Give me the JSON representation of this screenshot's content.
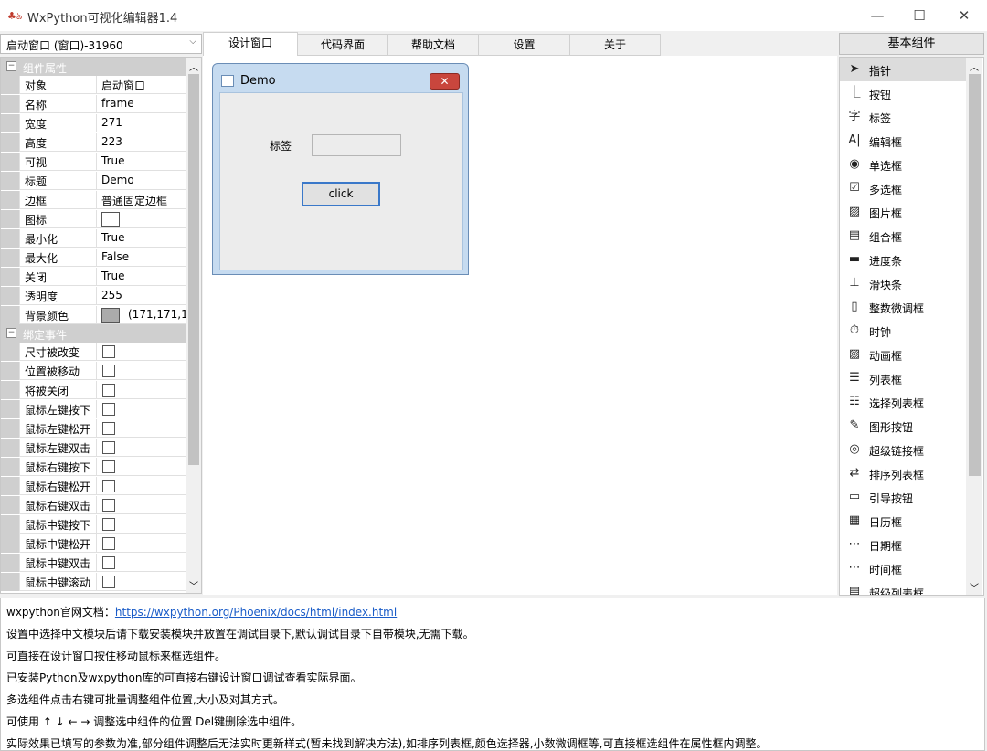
{
  "window": {
    "title": "WxPython可视化编辑器1.4",
    "minimize": "—",
    "maximize": "☐",
    "close": "✕"
  },
  "left": {
    "combo_value": "启动窗口 (窗口)-31960",
    "category1": "组件属性",
    "properties": [
      {
        "key": "对象",
        "value": "启动窗口"
      },
      {
        "key": "名称",
        "value": "frame"
      },
      {
        "key": "宽度",
        "value": "271"
      },
      {
        "key": "高度",
        "value": "223"
      },
      {
        "key": "可视",
        "value": "True"
      },
      {
        "key": "标题",
        "value": "Demo"
      },
      {
        "key": "边框",
        "value": "普通固定边框"
      },
      {
        "key": "图标",
        "value": ""
      },
      {
        "key": "最小化",
        "value": "True"
      },
      {
        "key": "最大化",
        "value": "False"
      },
      {
        "key": "关闭",
        "value": "True"
      },
      {
        "key": "透明度",
        "value": "255"
      },
      {
        "key": "背景颜色",
        "value": "(171,171,1"
      }
    ],
    "bg_swatch_color": "#ababab",
    "category2": "绑定事件",
    "events": [
      "尺寸被改变",
      "位置被移动",
      "将被关闭",
      "鼠标左键按下",
      "鼠标左键松开",
      "鼠标左键双击",
      "鼠标右键按下",
      "鼠标右键松开",
      "鼠标右键双击",
      "鼠标中键按下",
      "鼠标中键松开",
      "鼠标中键双击",
      "鼠标中键滚动"
    ]
  },
  "tabs": [
    "设计窗口",
    "代码界面",
    "帮助文档",
    "设置",
    "关于"
  ],
  "demo": {
    "title": "Demo",
    "label": "标签",
    "button": "click"
  },
  "right": {
    "header": "基本组件",
    "components": [
      {
        "icon": "➤",
        "label": "指针"
      },
      {
        "icon": "⎿",
        "label": "按钮"
      },
      {
        "icon": "字",
        "label": "标签"
      },
      {
        "icon": "A|",
        "label": "编辑框"
      },
      {
        "icon": "◉",
        "label": "单选框"
      },
      {
        "icon": "☑",
        "label": "多选框"
      },
      {
        "icon": "▨",
        "label": "图片框"
      },
      {
        "icon": "▤",
        "label": "组合框"
      },
      {
        "icon": "▬",
        "label": "进度条"
      },
      {
        "icon": "⊥",
        "label": "滑块条"
      },
      {
        "icon": "▯",
        "label": "整数微调框"
      },
      {
        "icon": "⏱",
        "label": "时钟"
      },
      {
        "icon": "▨",
        "label": "动画框"
      },
      {
        "icon": "☰",
        "label": "列表框"
      },
      {
        "icon": "☷",
        "label": "选择列表框"
      },
      {
        "icon": "✎",
        "label": "图形按钮"
      },
      {
        "icon": "◎",
        "label": "超级链接框"
      },
      {
        "icon": "⇄",
        "label": "排序列表框"
      },
      {
        "icon": "▭",
        "label": "引导按钮"
      },
      {
        "icon": "▦",
        "label": "日历框"
      },
      {
        "icon": "⋯",
        "label": "日期框"
      },
      {
        "icon": "⋯",
        "label": "时间框"
      },
      {
        "icon": "▤",
        "label": "超级列表框"
      }
    ]
  },
  "info": {
    "doc_prefix": "wxpython官网文档：",
    "doc_url": "https://wxpython.org/Phoenix/docs/html/index.html",
    "lines": [
      "设置中选择中文模块后请下载安装模块并放置在调试目录下,默认调试目录下自带模块,无需下载。",
      "可直接在设计窗口按住移动鼠标来框选组件。",
      "已安装Python及wxpython库的可直接右键设计窗口调试查看实际界面。",
      "多选组件点击右键可批量调整组件位置,大小及对其方式。",
      "可使用 ↑ ↓ ← → 调整选中组件的位置 Del键删除选中组件。",
      "实际效果已填写的参数为准,部分组件调整后无法实时更新样式(暂未找到解决方法),如排序列表框,颜色选择器,小数微调框等,可直接框选组件在属性框内调整。"
    ]
  }
}
